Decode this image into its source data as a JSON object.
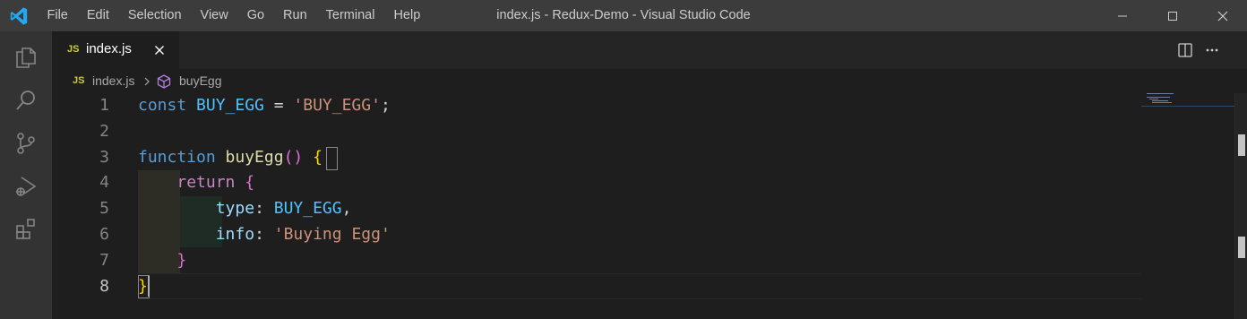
{
  "titlebar": {
    "menu": [
      "File",
      "Edit",
      "Selection",
      "View",
      "Go",
      "Run",
      "Terminal",
      "Help"
    ],
    "window_title": "index.js - Redux-Demo - Visual Studio Code"
  },
  "activity_bar": {
    "items": [
      "explorer-icon",
      "search-icon",
      "source-control-icon",
      "run-debug-icon",
      "extensions-icon"
    ]
  },
  "tab": {
    "badge": "JS",
    "filename": "index.js"
  },
  "breadcrumb": {
    "badge": "JS",
    "file": "index.js",
    "symbol": "buyEgg"
  },
  "editor": {
    "line_numbers": [
      "1",
      "2",
      "3",
      "4",
      "5",
      "6",
      "7",
      "8"
    ],
    "current_line": "8",
    "code": {
      "l1_kw": "const",
      "l1_name": "BUY_EGG",
      "l1_eq": " = ",
      "l1_str": "'BUY_EGG'",
      "l1_semi": ";",
      "l3_kw": "function",
      "l3_fn": "buyEgg",
      "l3_parens": "()",
      "l3_brace": "{",
      "l4_kw": "return",
      "l4_brace": "{",
      "l5_prop": "type",
      "l5_colon": ": ",
      "l5_val": "BUY_EGG",
      "l5_comma": ",",
      "l6_prop": "info",
      "l6_colon": ": ",
      "l6_str": "'Buying Egg'",
      "l7_brace": "}",
      "l8_brace": "}"
    }
  },
  "colors": {
    "titlebar": "#3c3c3c",
    "activity_bar": "#333333",
    "editor_bg": "#1e1e1e",
    "keyword": "#569cd6",
    "control_keyword": "#c586c0",
    "constant": "#4fc1ff",
    "string": "#ce9178",
    "function": "#dcdcaa",
    "property": "#9cdcfe",
    "bracket_level1": "#ffd700",
    "bracket_level2": "#da70d6",
    "js_badge": "#cbcb41"
  }
}
